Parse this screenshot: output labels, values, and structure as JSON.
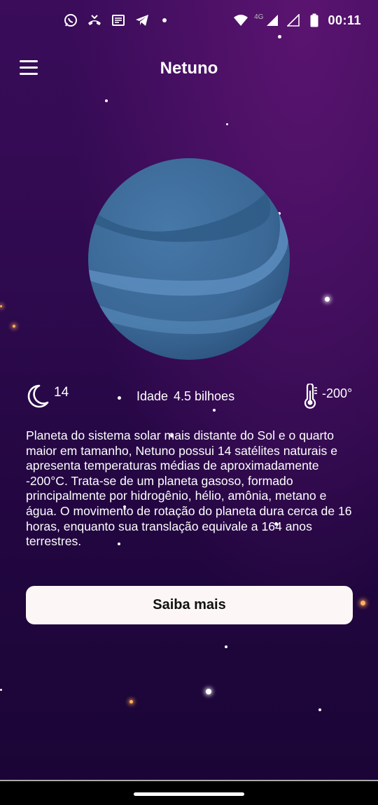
{
  "status_bar": {
    "time": "00:11",
    "network": "4G",
    "notification_icons": [
      "whatsapp-icon",
      "missed-call-icon",
      "news-icon",
      "telegram-icon"
    ]
  },
  "header": {
    "title": "Netuno",
    "menu_icon": "hamburger-menu-icon"
  },
  "planet": {
    "name": "Netuno",
    "colors": {
      "base": "#3f6d9c",
      "band": "#5a8bbd",
      "shadow": "#2c5078"
    }
  },
  "stats": {
    "satellites": "14",
    "age_label": "Idade",
    "age_value": "4.5 bilhoes",
    "temperature": "-200°"
  },
  "description": "Planeta do sistema solar mais distante do Sol e o quarto maior em tamanho, Netuno possui 14 satélites naturais e apresenta temperaturas médias de aproximadamente -200°C. Trata-se de um planeta gasoso, formado principalmente por hidrogênio, hélio, amônia, metano e água. O movimento de rotação do planeta dura cerca de 16 horas, enquanto sua translação equivale a 164 anos terrestres.",
  "cta": {
    "label": "Saiba mais"
  },
  "theme": {
    "background": "#2e0a4e",
    "button_bg": "#fcf7f6"
  }
}
